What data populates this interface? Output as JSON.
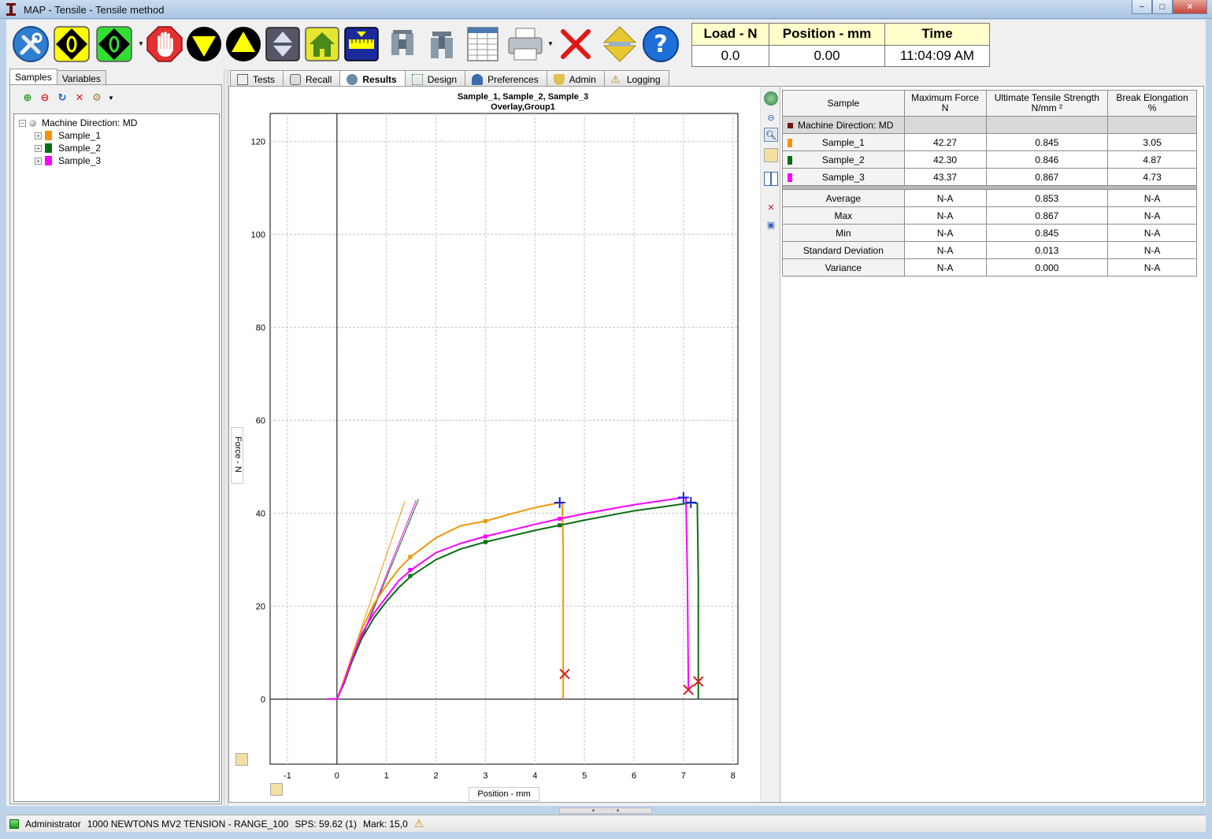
{
  "window": {
    "title": "MAP - Tensile - Tensile method",
    "min": "−",
    "max": "□",
    "close": "✕"
  },
  "toolbar": {
    "buttons": [
      "tools-icon",
      "zero-load-icon",
      "zero-position-icon",
      "stop-icon",
      "move-down-icon",
      "move-up-icon",
      "return-icon",
      "home-icon",
      "gauge-length-icon",
      "grip-open-icon",
      "grip-close-icon",
      "report-icon",
      "print-icon",
      "cancel-icon",
      "jog-icon",
      "help-icon"
    ]
  },
  "readouts": {
    "load": {
      "label": "Load - N",
      "value": "0.0"
    },
    "position": {
      "label": "Position - mm",
      "value": "0.00"
    },
    "time": {
      "label": "Time",
      "value": "11:04:09 AM"
    }
  },
  "left": {
    "tabs": [
      "Samples",
      "Variables"
    ],
    "tree": {
      "root": "Machine Direction: MD",
      "items": [
        {
          "label": "Sample_1",
          "color": "#f0960a"
        },
        {
          "label": "Sample_2",
          "color": "#0a6e14"
        },
        {
          "label": "Sample_3",
          "color": "#ff00ff"
        }
      ]
    }
  },
  "tabs": [
    "Tests",
    "Recall",
    "Results",
    "Design",
    "Preferences",
    "Admin",
    "Logging"
  ],
  "chart": {
    "title_line1": "Sample_1, Sample_2, Sample_3",
    "title_line2": "Overlay,Group1",
    "ylabel": "Force - N",
    "xlabel": "Position - mm"
  },
  "chart_data": {
    "type": "line",
    "title": "Sample_1, Sample_2, Sample_3 Overlay,Group1",
    "xlabel": "Position - mm",
    "ylabel": "Force - N",
    "xlim": [
      -1.35,
      8.1
    ],
    "ylim": [
      -14,
      126
    ],
    "xticks": [
      -1,
      0,
      1,
      2,
      3,
      4,
      5,
      6,
      7,
      8
    ],
    "yticks": [
      0,
      20,
      40,
      60,
      80,
      100,
      120
    ],
    "grid": true,
    "series": [
      {
        "name": "Sample_1",
        "color": "#f0960a",
        "x": [
          -0.2,
          0,
          0.15,
          0.3,
          0.5,
          0.75,
          1.0,
          1.25,
          1.5,
          2.0,
          2.5,
          3.0,
          3.5,
          4.0,
          4.5,
          4.55,
          4.57,
          4.57
        ],
        "y": [
          0,
          0,
          4,
          9,
          15,
          20.5,
          24.5,
          28,
          30.7,
          34.7,
          37.3,
          38.3,
          39.8,
          41.2,
          42.27,
          42.1,
          33,
          0
        ]
      },
      {
        "name": "Sample_2",
        "color": "#0a6e14",
        "x": [
          -0.2,
          0,
          0.15,
          0.3,
          0.5,
          0.75,
          1.0,
          1.25,
          1.5,
          2.0,
          2.5,
          3.0,
          4.0,
          4.5,
          5.0,
          6.0,
          7.0,
          7.15,
          7.28,
          7.3,
          7.3
        ],
        "y": [
          0,
          0,
          3.5,
          8,
          13,
          17.5,
          21,
          24,
          26.5,
          30,
          32.3,
          33.8,
          36.3,
          37.4,
          38.5,
          40.5,
          42.0,
          42.3,
          42.1,
          26,
          0
        ]
      },
      {
        "name": "Sample_3",
        "color": "#ff00ff",
        "x": [
          -0.2,
          0,
          0.15,
          0.3,
          0.5,
          0.75,
          1.0,
          1.25,
          1.5,
          2.0,
          2.5,
          3.0,
          4.0,
          4.5,
          5.0,
          6.0,
          7.0,
          7.05,
          7.08,
          7.1
        ],
        "y": [
          0,
          0,
          3.8,
          8.5,
          14,
          18.5,
          22,
          25.5,
          27.8,
          31.5,
          33.5,
          35,
          37.6,
          38.8,
          39.9,
          41.8,
          43.37,
          43.2,
          26,
          2
        ]
      }
    ],
    "modulus_lines": [
      {
        "color": "#f0960a",
        "x": [
          0,
          1.37
        ],
        "y": [
          0,
          42.5
        ]
      },
      {
        "color": "#0a6e14",
        "x": [
          0,
          1.65
        ],
        "y": [
          0,
          43
        ]
      },
      {
        "color": "#ff00ff",
        "x": [
          0,
          1.6
        ],
        "y": [
          0,
          42.8
        ]
      }
    ],
    "markers": [
      {
        "x": 1.48,
        "y": 30.6,
        "color": "#f0960a"
      },
      {
        "x": 3.0,
        "y": 38.3,
        "color": "#f0960a"
      },
      {
        "x": 1.48,
        "y": 26.5,
        "color": "#0a6e14"
      },
      {
        "x": 3.0,
        "y": 33.8,
        "color": "#0a6e14"
      },
      {
        "x": 4.5,
        "y": 37.4,
        "color": "#0a6e14"
      },
      {
        "x": 1.48,
        "y": 27.8,
        "color": "#ff00ff"
      },
      {
        "x": 3.0,
        "y": 35.0,
        "color": "#ff00ff"
      },
      {
        "x": 4.5,
        "y": 38.8,
        "color": "#ff00ff"
      }
    ],
    "max_points": [
      {
        "x": 4.5,
        "y": 42.27
      },
      {
        "x": 7.0,
        "y": 43.37
      },
      {
        "x": 7.15,
        "y": 42.3
      }
    ],
    "break_points": [
      {
        "x": 4.6,
        "y": 5.4
      },
      {
        "x": 7.1,
        "y": 2.0
      },
      {
        "x": 7.3,
        "y": 3.8
      }
    ]
  },
  "results": {
    "headers": [
      {
        "line1": "Sample",
        "line2": ""
      },
      {
        "line1": "Maximum Force",
        "line2": "N"
      },
      {
        "line1": "Ultimate Tensile Strength",
        "line2": "N/mm ²"
      },
      {
        "line1": "Break Elongation",
        "line2": "%"
      }
    ],
    "group": "Machine Direction: MD",
    "samples": [
      {
        "name": "Sample_1",
        "color": "#f0960a",
        "max_force": "42.27",
        "uts": "0.845",
        "break_elong": "3.05"
      },
      {
        "name": "Sample_2",
        "color": "#0a6e14",
        "max_force": "42.30",
        "uts": "0.846",
        "break_elong": "4.87"
      },
      {
        "name": "Sample_3",
        "color": "#ff00ff",
        "max_force": "43.37",
        "uts": "0.867",
        "break_elong": "4.73"
      }
    ],
    "stats": [
      {
        "name": "Average",
        "max_force": "N-A",
        "uts": "0.853",
        "break_elong": "N-A"
      },
      {
        "name": "Max",
        "max_force": "N-A",
        "uts": "0.867",
        "break_elong": "N-A"
      },
      {
        "name": "Min",
        "max_force": "N-A",
        "uts": "0.845",
        "break_elong": "N-A"
      },
      {
        "name": "Standard Deviation",
        "max_force": "N-A",
        "uts": "0.013",
        "break_elong": "N-A"
      },
      {
        "name": "Variance",
        "max_force": "N-A",
        "uts": "0.000",
        "break_elong": "N-A"
      }
    ]
  },
  "status": {
    "user": "Administrator",
    "machine": "1000 NEWTONS MV2 TENSION - RANGE_100",
    "sps": "SPS: 59.62 (1)",
    "mark": "Mark: 15,0"
  }
}
